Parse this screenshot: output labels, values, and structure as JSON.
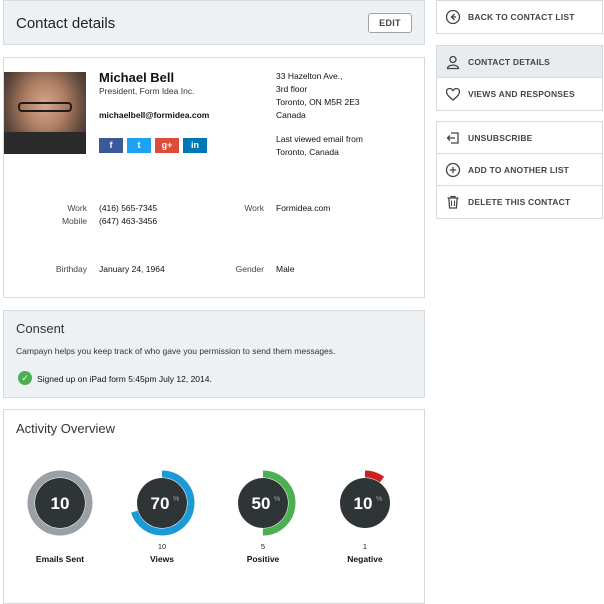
{
  "contact_details": {
    "title": "Contact details",
    "edit_label": "EDIT"
  },
  "contact": {
    "name": "Michael Bell",
    "job_title": "President, Form Idea Inc.",
    "email": "michaelbell@formidea.com",
    "address": [
      "33 Hazelton Ave.,",
      "3rd floor",
      "Toronto, ON M5R 2E3",
      "Canada"
    ],
    "last_viewed_label": "Last viewed email from",
    "last_viewed_location": "Toronto, Canada",
    "social": [
      {
        "icon": "facebook-icon",
        "glyph": "f",
        "color": "#3b5998"
      },
      {
        "icon": "twitter-icon",
        "glyph": "t",
        "color": "#1da1f2"
      },
      {
        "icon": "google-plus-icon",
        "glyph": "g+",
        "color": "#dd4b39"
      },
      {
        "icon": "linkedin-icon",
        "glyph": "in",
        "color": "#0077b5"
      }
    ],
    "phones": {
      "work_label": "Work",
      "work_value": "(416) 565-7345",
      "mobile_label": "Mobile",
      "mobile_value": "(647) 463-3456"
    },
    "website": {
      "label": "Work",
      "value": "Formidea.com"
    },
    "birthday": {
      "label": "Birthday",
      "value": "January 24, 1964"
    },
    "gender": {
      "label": "Gender",
      "value": "Male"
    }
  },
  "consent": {
    "title": "Consent",
    "description": "Campayn helps you keep track of who gave you permission to send them messages.",
    "signed_up": "Signed up on iPad form 5:45pm July 12, 2014."
  },
  "activity": {
    "title": "Activity Overview",
    "stats": [
      {
        "value": "10",
        "unit": "",
        "count": "",
        "label": "Emails Sent",
        "fraction": 1.0,
        "color": "#9aa0a6"
      },
      {
        "value": "70",
        "unit": "%",
        "count": "10",
        "label": "Views",
        "fraction": 0.7,
        "color": "#1a9ad6"
      },
      {
        "value": "50",
        "unit": "%",
        "count": "5",
        "label": "Positive",
        "fraction": 0.5,
        "color": "#4caf50"
      },
      {
        "value": "10",
        "unit": "%",
        "count": "1",
        "label": "Negative",
        "fraction": 0.1,
        "color": "#cc1f1f"
      }
    ]
  },
  "sidebar": {
    "back": {
      "label": "BACK TO CONTACT LIST",
      "icon": "arrow-left-circle-icon"
    },
    "nav": [
      {
        "label": "CONTACT DETAILS",
        "icon": "user-icon",
        "active": true
      },
      {
        "label": "VIEWS AND RESPONSES",
        "icon": "heart-icon",
        "active": false
      }
    ],
    "actions": [
      {
        "label": "UNSUBSCRIBE",
        "icon": "unsubscribe-icon"
      },
      {
        "label": "ADD TO ANOTHER LIST",
        "icon": "plus-circle-icon"
      },
      {
        "label": "DELETE THIS CONTACT",
        "icon": "trash-icon"
      }
    ]
  }
}
